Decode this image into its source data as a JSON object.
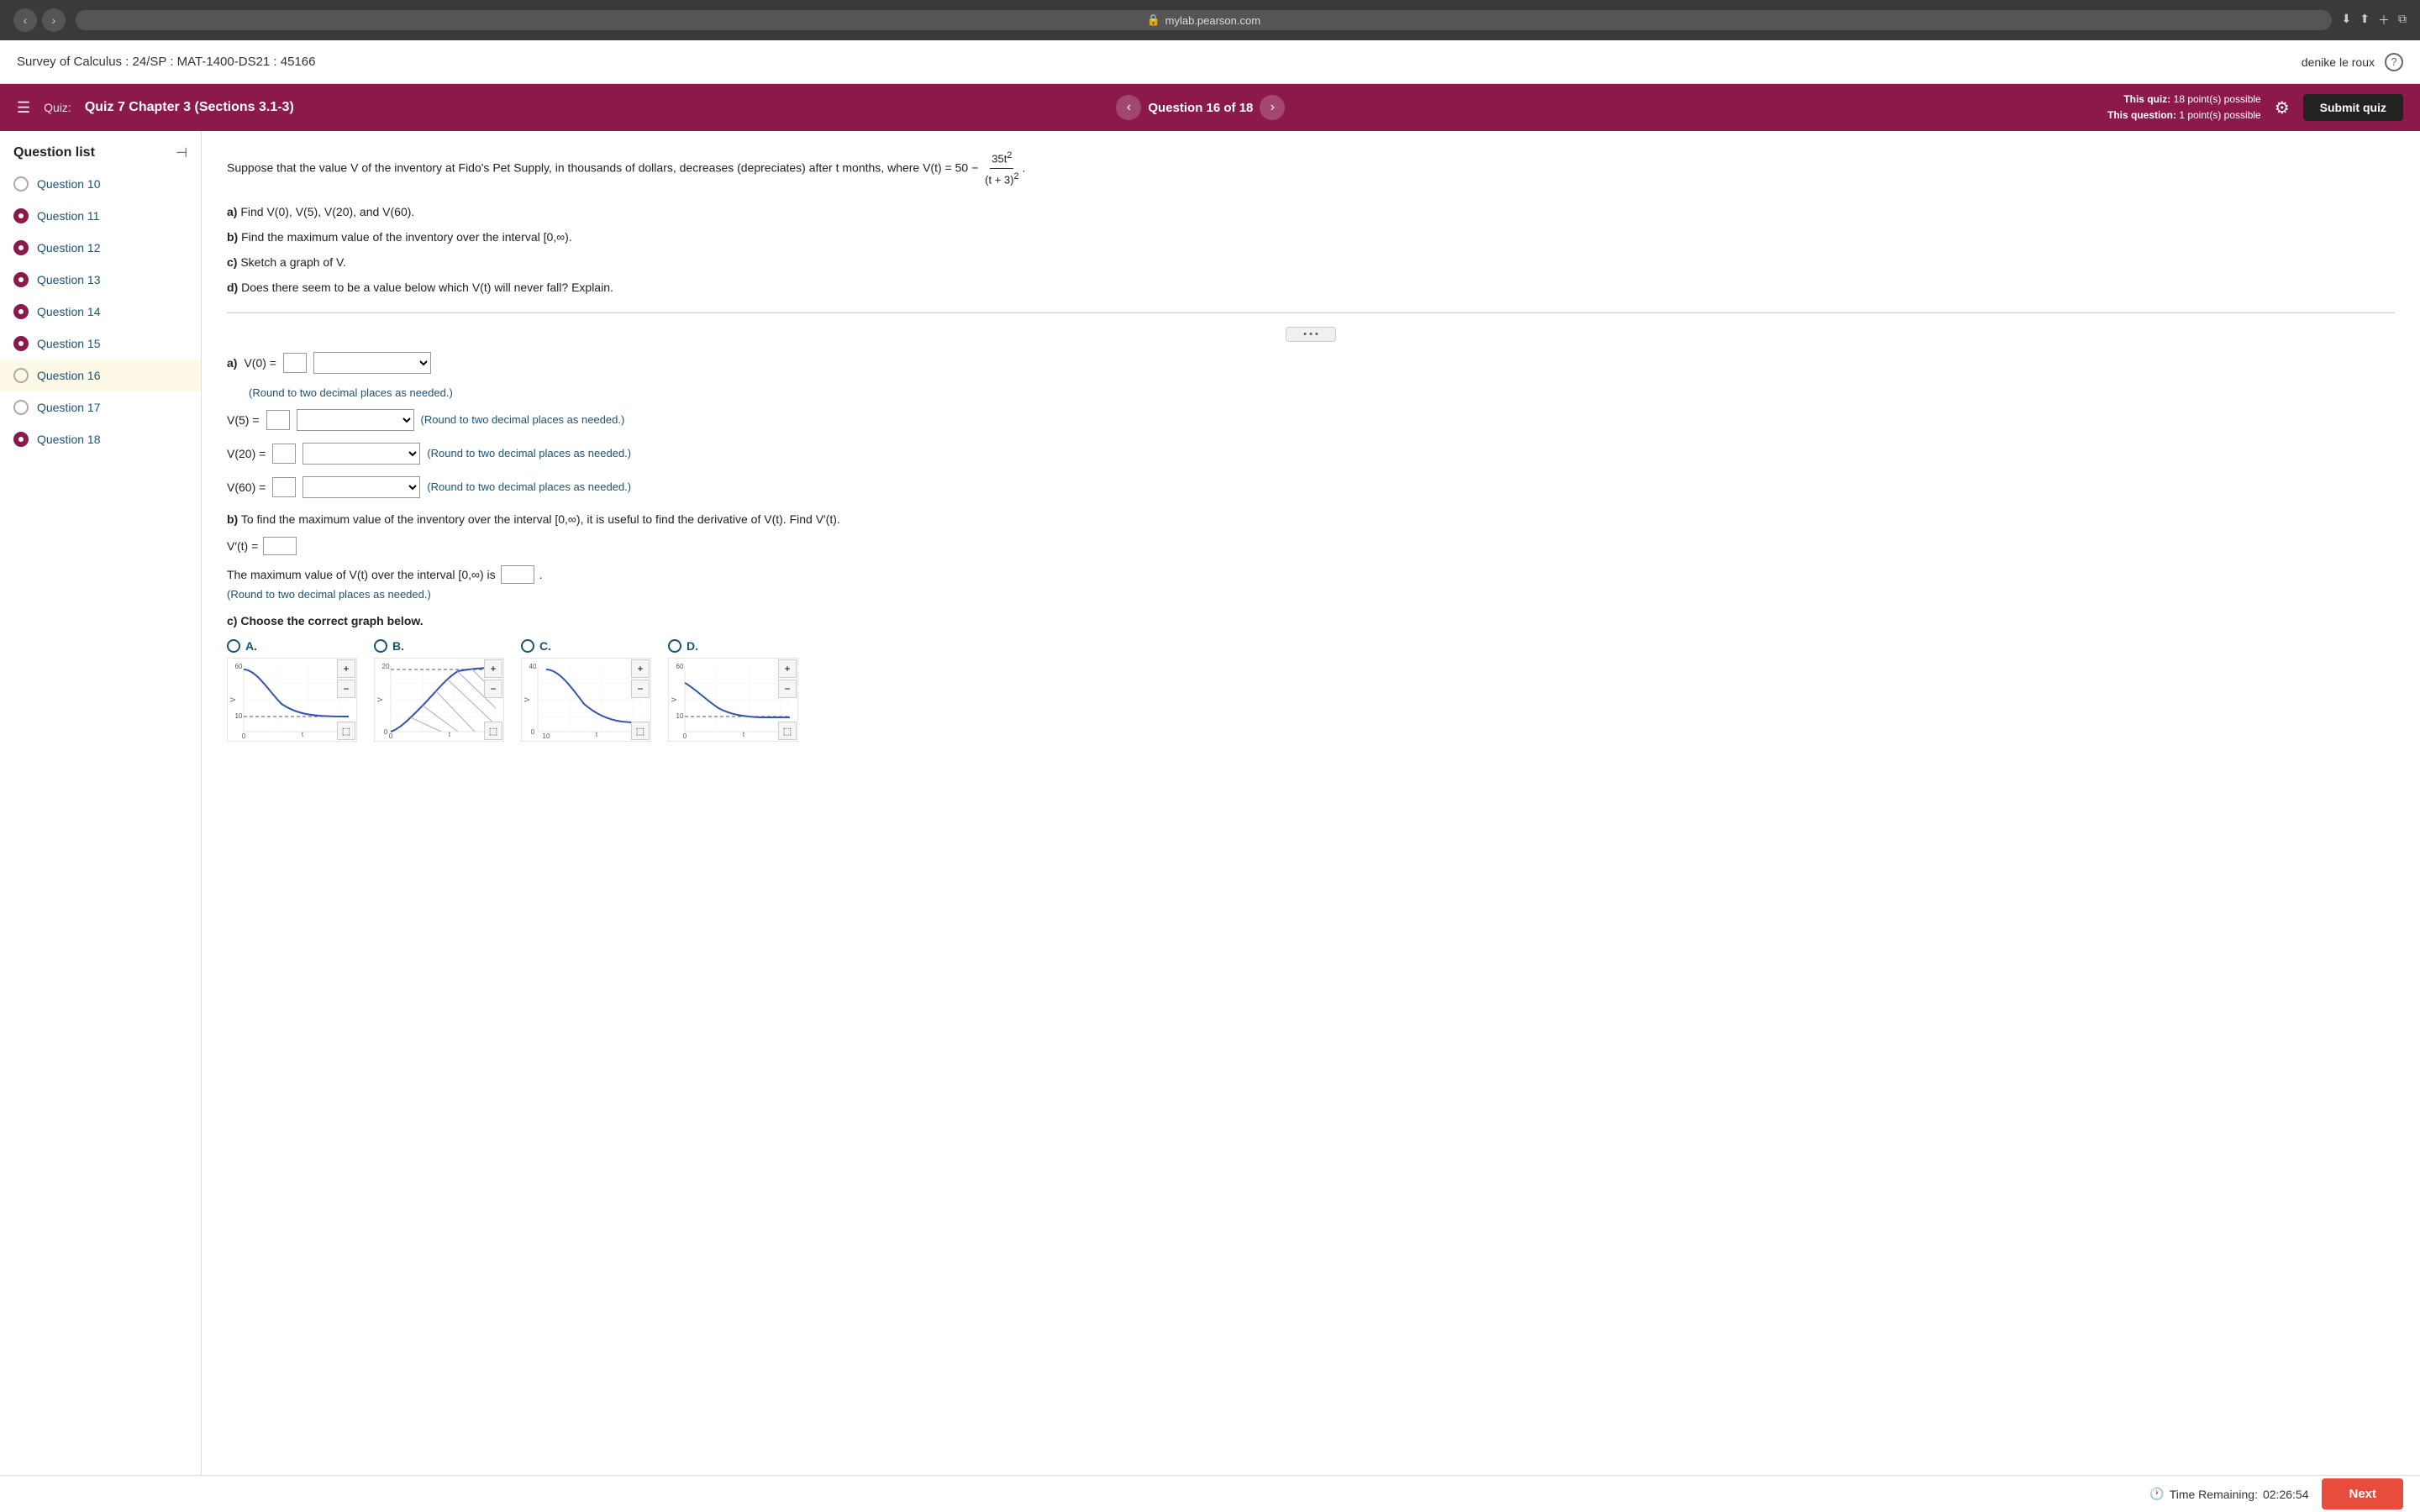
{
  "browser": {
    "url": "mylab.pearson.com",
    "lock_icon": "🔒"
  },
  "app_header": {
    "title": "Survey of Calculus : 24/SP : MAT-1400-DS21 : 45166",
    "user": "denike le roux",
    "help_label": "?"
  },
  "quiz_header": {
    "menu_icon": "☰",
    "quiz_label": "Quiz:",
    "quiz_title": "Quiz 7 Chapter 3 (Sections 3.1-3)",
    "question_indicator": "Question 16 of 18",
    "quiz_points": "This quiz: 18 point(s) possible",
    "question_points": "This question: 1 point(s) possible",
    "submit_label": "Submit quiz"
  },
  "sidebar": {
    "title": "Question list",
    "questions": [
      {
        "id": "q10",
        "label": "Question 10",
        "state": "empty"
      },
      {
        "id": "q11",
        "label": "Question 11",
        "state": "filled"
      },
      {
        "id": "q12",
        "label": "Question 12",
        "state": "filled"
      },
      {
        "id": "q13",
        "label": "Question 13",
        "state": "filled"
      },
      {
        "id": "q14",
        "label": "Question 14",
        "state": "filled"
      },
      {
        "id": "q15",
        "label": "Question 15",
        "state": "filled"
      },
      {
        "id": "q16",
        "label": "Question 16",
        "state": "active"
      },
      {
        "id": "q17",
        "label": "Question 17",
        "state": "empty"
      },
      {
        "id": "q18",
        "label": "Question 18",
        "state": "filled"
      }
    ]
  },
  "question": {
    "intro": "Suppose that the value V of the inventory at Fido's Pet Supply, in thousands of dollars, decreases (depreciates) after t months, where V(t) = 50 −",
    "fraction_num": "35t²",
    "fraction_den": "(t + 3)²",
    "period": ".",
    "part_a_label": "a)",
    "part_a_text": "Find V(0), V(5), V(20), and V(60).",
    "part_b_label": "b)",
    "part_b_text": "Find the maximum value of the inventory over the interval [0,∞).",
    "part_c_label": "c)",
    "part_c_text": "Sketch a graph of V.",
    "part_d_label": "d)",
    "part_d_text": "Does there seem to be a value below which V(t) will never fall? Explain.",
    "v0_label": "V(0) =",
    "v5_label": "V(5) =",
    "v20_label": "V(20) =",
    "v60_label": "V(60) =",
    "round_note": "(Round to two decimal places as needed.)",
    "part_b_intro": "To find the maximum value of the inventory over the interval [0,∞), it is useful to find the derivative of V(t). Find V′(t).",
    "vprime_label": "V′(t) =",
    "max_value_intro": "The maximum value of V(t) over the interval [0,∞) is",
    "max_round_note": "(Round to two decimal places as needed.)",
    "part_c_choose": "c) Choose the correct graph below.",
    "graph_options": [
      {
        "id": "A",
        "label": "A.",
        "x_max": "40",
        "y_max": "60",
        "y_min": "10",
        "type": "decreasing"
      },
      {
        "id": "B",
        "label": "B.",
        "x_max": "150",
        "y_max": "20",
        "y_min": "0",
        "type": "increasing"
      },
      {
        "id": "C",
        "label": "C.",
        "x_max": "60",
        "y_max": "40",
        "y_min": "0",
        "x_min": "10",
        "type": "decreasing_curve"
      },
      {
        "id": "D",
        "label": "D.",
        "x_max": "40",
        "y_max": "60",
        "y_min": "10",
        "type": "decreasing2"
      }
    ]
  },
  "footer": {
    "time_label": "Time Remaining:",
    "time_value": "02:26:54",
    "next_label": "Next"
  }
}
